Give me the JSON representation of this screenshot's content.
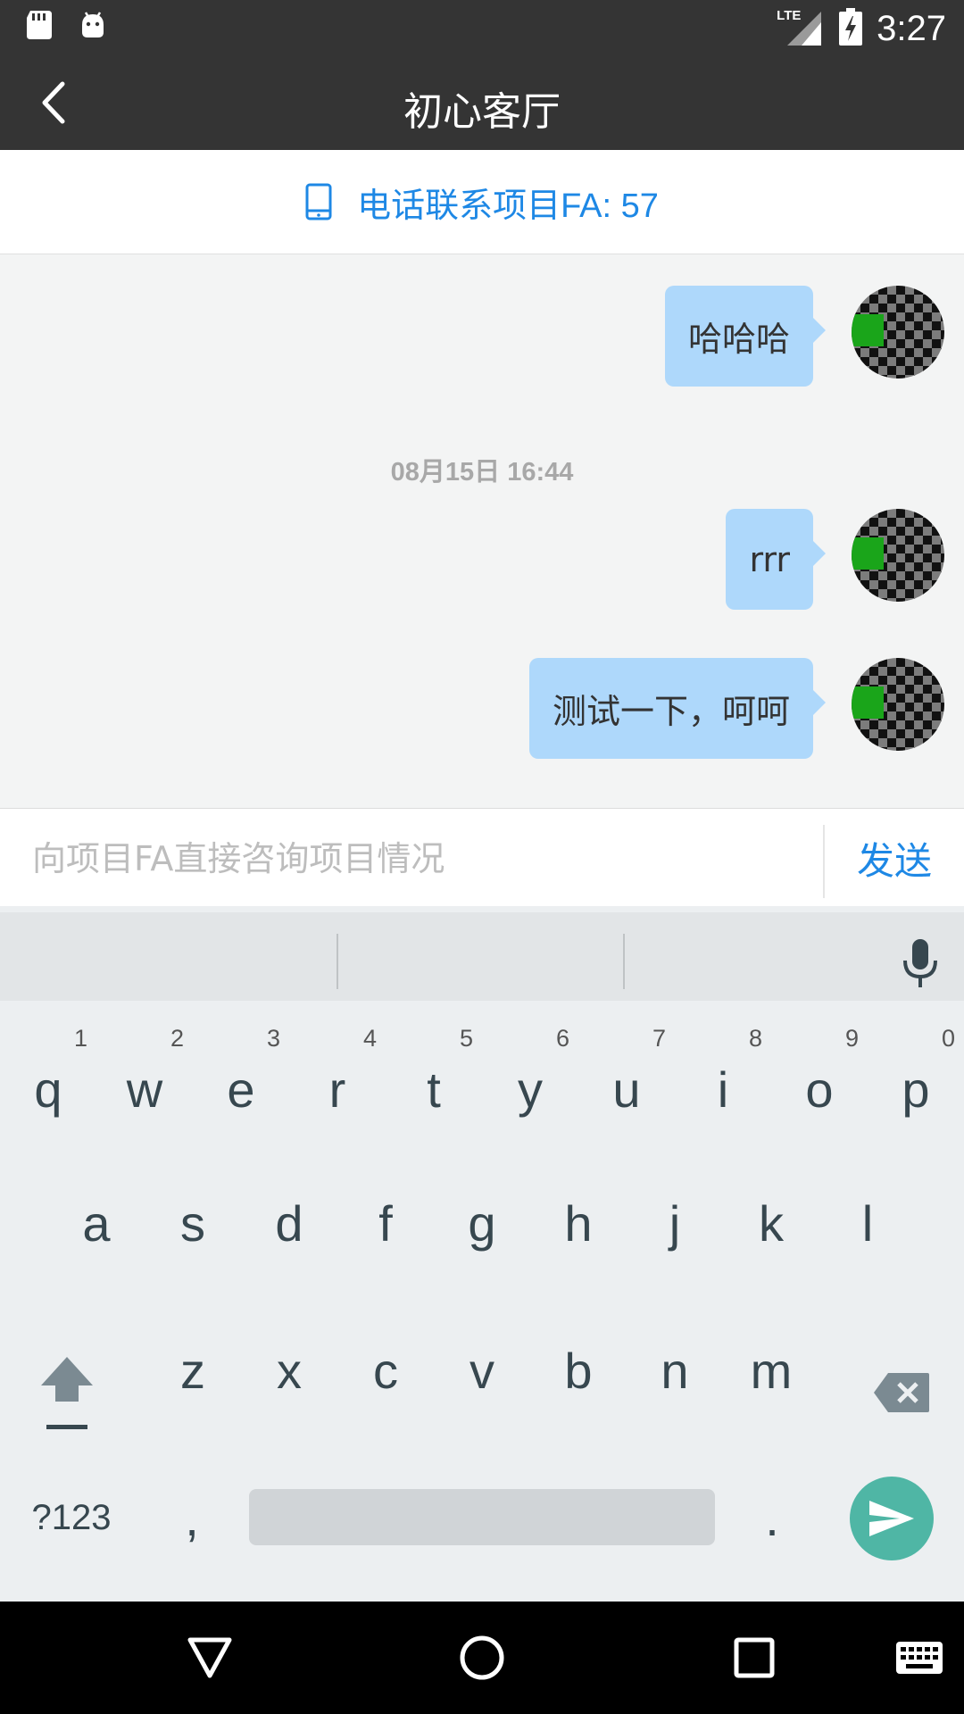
{
  "status_bar": {
    "time": "3:27",
    "network": "LTE",
    "icons": [
      "sd-card-icon",
      "android-icon",
      "signal-icon",
      "battery-charging-icon"
    ]
  },
  "app_bar": {
    "title": "初心客厅",
    "back_icon": "back-arrow-icon"
  },
  "contact": {
    "label": "电话联系项目FA: 57",
    "icon": "phone-icon"
  },
  "messages": [
    {
      "type": "text",
      "text": "哈哈哈",
      "from": "me"
    },
    {
      "type": "time",
      "text": "08月15日 16:44"
    },
    {
      "type": "text",
      "text": "rrr",
      "from": "me"
    },
    {
      "type": "text",
      "text": "测试一下，呵呵",
      "from": "me"
    }
  ],
  "composer": {
    "placeholder": "向项目FA直接咨询项目情况",
    "value": "",
    "send_label": "发送"
  },
  "keyboard": {
    "row1": [
      {
        "k": "q",
        "h": "1"
      },
      {
        "k": "w",
        "h": "2"
      },
      {
        "k": "e",
        "h": "3"
      },
      {
        "k": "r",
        "h": "4"
      },
      {
        "k": "t",
        "h": "5"
      },
      {
        "k": "y",
        "h": "6"
      },
      {
        "k": "u",
        "h": "7"
      },
      {
        "k": "i",
        "h": "8"
      },
      {
        "k": "o",
        "h": "9"
      },
      {
        "k": "p",
        "h": "0"
      }
    ],
    "row2": [
      "a",
      "s",
      "d",
      "f",
      "g",
      "h",
      "j",
      "k",
      "l"
    ],
    "row3": [
      "z",
      "x",
      "c",
      "v",
      "b",
      "n",
      "m"
    ],
    "symbols_label": "?123",
    "comma": ",",
    "period": "."
  },
  "colors": {
    "accent": "#1e88e5",
    "bubble": "#aed8fb",
    "bar": "#343434",
    "keyboard_action": "#4fb6a5"
  }
}
